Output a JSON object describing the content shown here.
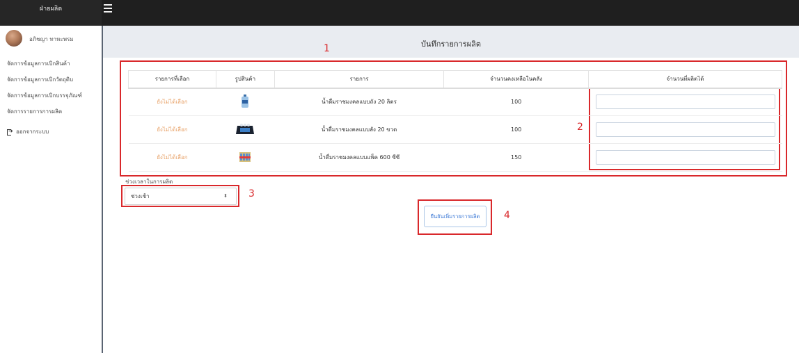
{
  "app": {
    "brand": "ฝ่ายผลิต",
    "user_name": "อภิชญา ทาหะพรม"
  },
  "sidebar": {
    "items": [
      {
        "label": "จัดการข้อมูลการเบิกสินค้า",
        "icon": ""
      },
      {
        "label": "จัดการข้อมูลการเบิกวัตถุดิบ",
        "icon": ""
      },
      {
        "label": "จัดการข้อมูลการเบิกบรรจุภัณฑ์",
        "icon": ""
      },
      {
        "label": "จัดการรายการการผลิต",
        "icon": ""
      },
      {
        "label": "ออกจากระบบ",
        "icon": "logout-icon"
      }
    ]
  },
  "header": {
    "title": "บันทึกรายการผลิต"
  },
  "table": {
    "columns": [
      "รายการที่เลือก",
      "รูปสินค้า",
      "รายการ",
      "จำนวนคงเหลือในคลัง",
      "จำนวนที่ผลิตได้"
    ],
    "rows": [
      {
        "status": "ยังไม่ได้เลือก",
        "image": "water-tank-20l-icon",
        "name": "น้ำดื่มราชมงคลแบบถัง 20 ลิตร",
        "stock": "100",
        "produced": ""
      },
      {
        "status": "ยังไม่ได้เลือก",
        "image": "water-crate-20-bottles-icon",
        "name": "น้ำดื่มราชมงคลแบบลัง 20 ขวด",
        "stock": "100",
        "produced": ""
      },
      {
        "status": "ยังไม่ได้เลือก",
        "image": "water-pack-600ml-icon",
        "name": "น้ำดื่มราชมงคลแบบแพ็ค 600 ซีซี",
        "stock": "150",
        "produced": ""
      }
    ]
  },
  "form": {
    "period_label": "ช่วงเวลาในการผลิต",
    "period_value": "ช่วงเช้า",
    "confirm_label": "ยืนยันเพิ่มรายการผลิต"
  },
  "annotations": [
    "1",
    "2",
    "3",
    "4"
  ],
  "colors": {
    "annotation": "#d9282b",
    "status": "#e8a36a",
    "button_text": "#3d7ad6",
    "topbar": "#1f1f1f"
  }
}
